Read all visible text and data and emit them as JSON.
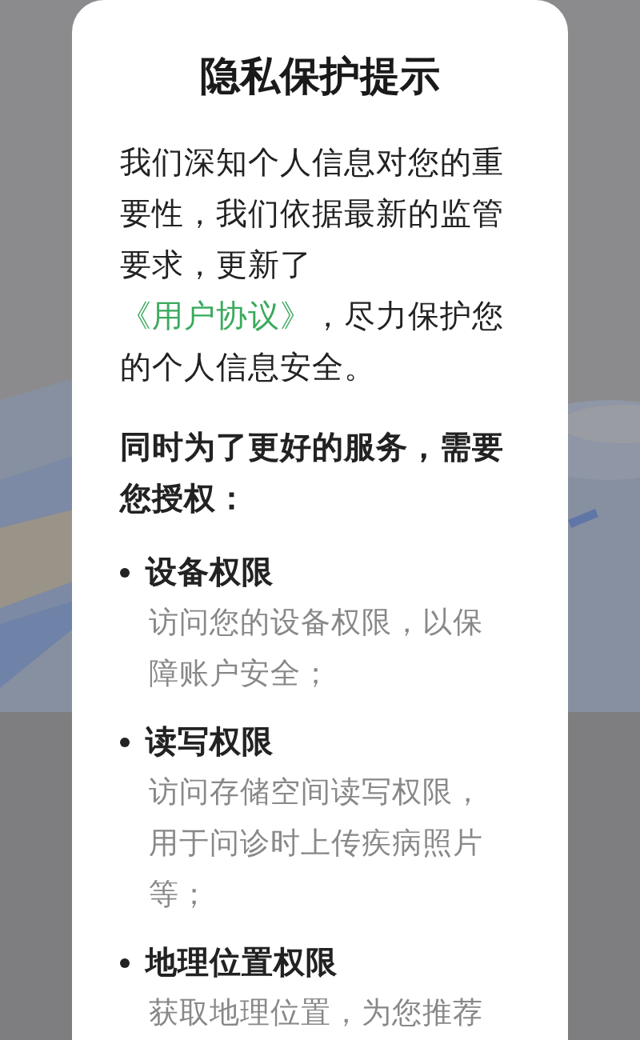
{
  "dialog": {
    "title": "隐私保护提示",
    "intro": {
      "before": "我们深知个人信息对您的重要性，我们依据最新的监管要求，更新了",
      "link": "《用户协议》",
      "after": "，尽力保护您的个人信息安全。"
    },
    "request": "同时为了更好的服务，需要您授权：",
    "permissions": [
      {
        "name": "设备权限",
        "description": "访问您的设备权限，以保障账户安全；"
      },
      {
        "name": "读写权限",
        "description": "访问存储空间读写权限，用于问诊时上传疾病照片等；"
      },
      {
        "name": "地理位置权限",
        "description": "获取地理位置，为您推荐"
      }
    ]
  }
}
